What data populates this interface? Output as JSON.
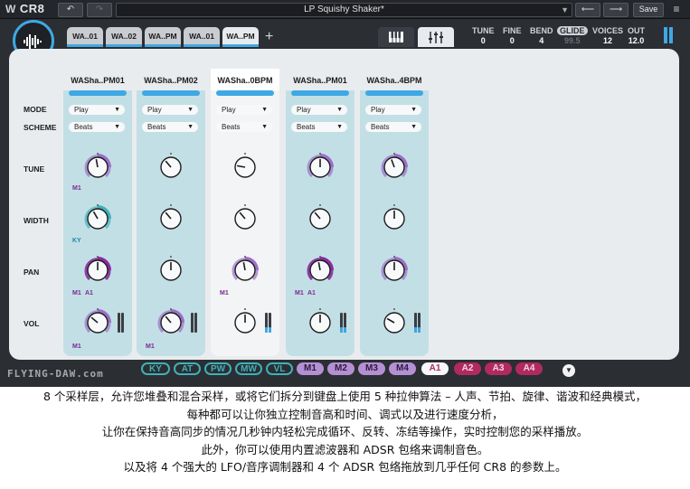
{
  "app": {
    "logo_text": "CR8",
    "undo_icon": "undo-icon",
    "redo_icon": "redo-icon",
    "preset_name": "LP Squishy Shaker*",
    "preset_arrow": "▼",
    "prev_label": "⟵",
    "next_label": "⟶",
    "save_label": "Save",
    "menu_icon": "≡"
  },
  "tabs": [
    {
      "label": "WA..01",
      "s": "S"
    },
    {
      "label": "WA..02",
      "s": "S"
    },
    {
      "label": "WA..PM",
      "s": "S"
    },
    {
      "label": "WA..01",
      "s": "S"
    },
    {
      "label": "WA..PM",
      "s": "S"
    }
  ],
  "add_tab_label": "+",
  "header": {
    "tune": {
      "label": "TUNE",
      "value": "0"
    },
    "fine": {
      "label": "FINE",
      "value": "0"
    },
    "bend": {
      "label": "BEND",
      "value": "4"
    },
    "glide": {
      "label": "GLIDE",
      "value": "99.5"
    },
    "voices": {
      "label": "VOICES",
      "value": "12"
    },
    "out": {
      "label": "OUT",
      "value": "12.0"
    }
  },
  "rows": {
    "mode": "MODE",
    "scheme": "SCHEME",
    "tune": "TUNE",
    "width": "WIDTH",
    "pan": "PAN",
    "vol": "VOL"
  },
  "strips": [
    {
      "name": "WASha..PM01",
      "mode": "Play",
      "scheme": "Beats",
      "tune_mod": "M1",
      "width_mod": "KY",
      "pan_mod1": "M1",
      "pan_mod2": "A1",
      "vol_mod": "M1"
    },
    {
      "name": "WASha..PM02",
      "mode": "Play",
      "scheme": "Beats",
      "tune_mod": "",
      "width_mod": "",
      "pan_mod1": "",
      "pan_mod2": "",
      "vol_mod": "M1"
    },
    {
      "name": "WASha..0BPM",
      "mode": "Play",
      "scheme": "Beats",
      "tune_mod": "",
      "width_mod": "",
      "pan_mod1": "M1",
      "pan_mod2": "",
      "vol_mod": ""
    },
    {
      "name": "WASha..PM01",
      "mode": "Play",
      "scheme": "Beats",
      "tune_mod": "",
      "width_mod": "",
      "pan_mod1": "M1",
      "pan_mod2": "A1",
      "vol_mod": ""
    },
    {
      "name": "WASha..4BPM",
      "mode": "Play",
      "scheme": "Beats",
      "tune_mod": "",
      "width_mod": "",
      "pan_mod1": "",
      "pan_mod2": "",
      "vol_mod": ""
    }
  ],
  "modulators": {
    "controls": [
      "KY",
      "AT",
      "PW",
      "MW",
      "VL"
    ],
    "lfos": [
      "M1",
      "M2",
      "M3",
      "M4"
    ],
    "envs": [
      "A1",
      "A2",
      "A3",
      "A4"
    ],
    "expand_icon": "▼"
  },
  "watermark": "FLYING-DAW.com",
  "caption": [
    "8 个采样层，允许您堆叠和混合采样，或将它们拆分到键盘上使用 5 种拉伸算法 – 人声、节拍、旋律、谐波和经典模式，",
    "每种都可以让你独立控制音高和时间、调式以及进行速度分析，",
    "让你在保持音高同步的情况几秒钟内轻松完成循环、反转、冻结等操作，实时控制您的采样播放。",
    "此外，你可以使用内置滤波器和 ADSR 包络来调制音色。",
    "以及将 4 个强大的 LFO/音序调制器和 4 个 ADSR 包络拖放到几乎任何 CR8 的参数上。"
  ],
  "colors": {
    "accent": "#3fa8e4",
    "lfo": "#b58fd4",
    "env": "#b02a5f",
    "ctl": "#3fb1b8"
  }
}
